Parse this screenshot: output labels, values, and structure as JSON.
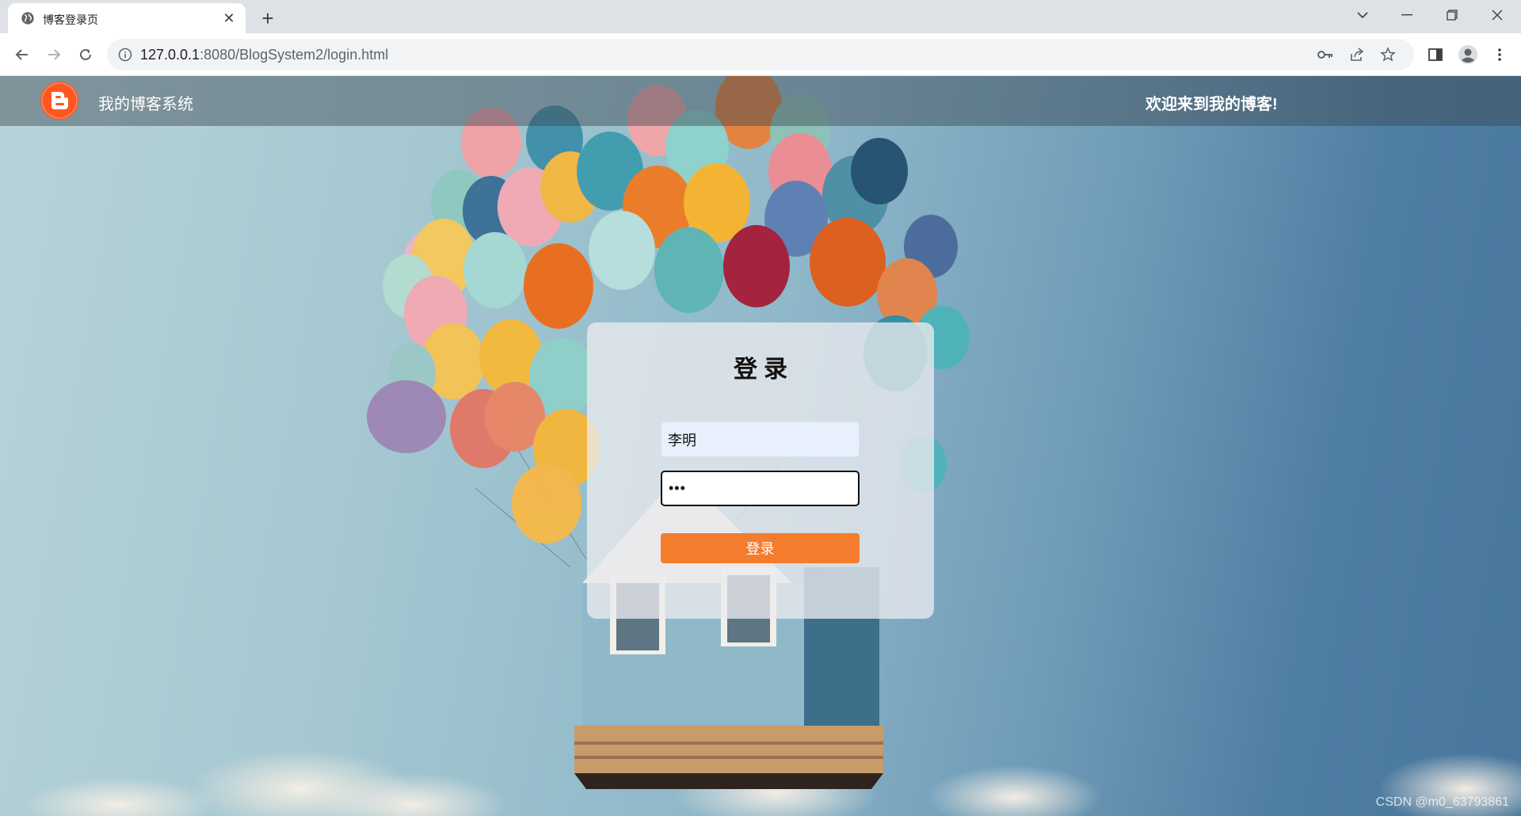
{
  "browser": {
    "tab_title": "博客登录页",
    "tab_close": "✕",
    "new_tab": "+",
    "url_host": "127.0.0.1",
    "url_path": ":8080/BlogSystem2/login.html"
  },
  "page": {
    "site_name": "我的博客系统",
    "welcome": "欢迎来到我的博客!",
    "login": {
      "title": "登录",
      "username_value": "李明",
      "password_value": "•••",
      "button_label": "登录"
    },
    "watermark": "CSDN @m0_63793861"
  },
  "colors": {
    "accent": "#f47c2d",
    "logo": "#ff5722"
  },
  "icons": {
    "tab_favicon": "globe-icon",
    "back": "arrow-left-icon",
    "forward": "arrow-right-icon",
    "reload": "reload-icon",
    "site_info": "info-icon",
    "password_key": "key-icon",
    "share": "share-icon",
    "bookmark": "star-icon",
    "side_panel": "side-panel-icon",
    "profile": "profile-icon",
    "menu": "kebab-menu-icon",
    "logo": "blogger-logo-icon"
  }
}
